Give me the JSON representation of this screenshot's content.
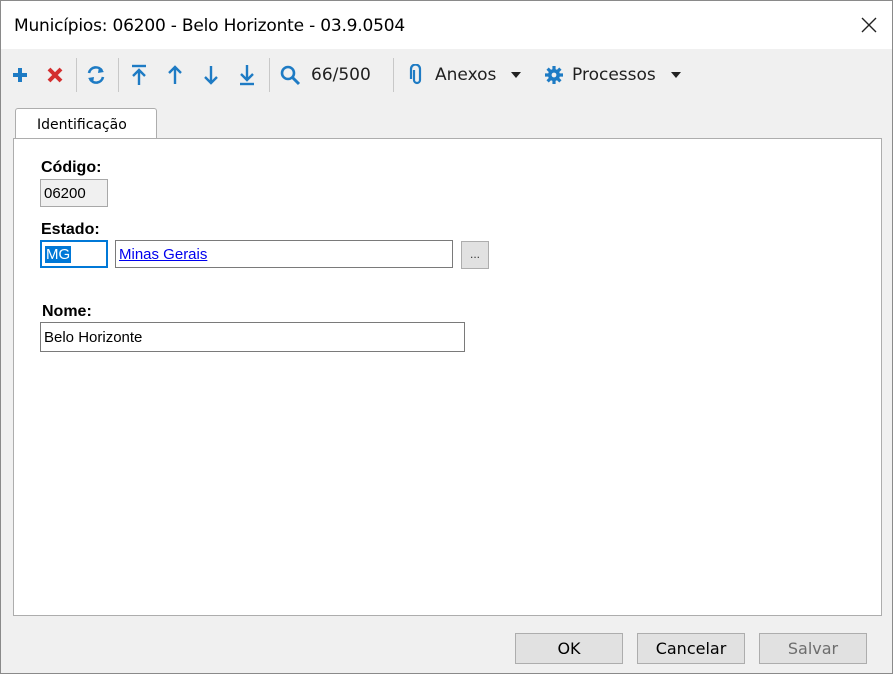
{
  "window": {
    "title": "Municípios: 06200 - Belo Horizonte - 03.9.0504"
  },
  "toolbar": {
    "record_counter": "66/500",
    "attachments_label": "Anexos",
    "processes_label": "Processos"
  },
  "tabs": [
    {
      "label": "Identificação",
      "active": true
    }
  ],
  "form": {
    "codigo": {
      "label": "Código:",
      "value": "06200"
    },
    "estado": {
      "label": "Estado:",
      "code": "MG",
      "name": "Minas Gerais",
      "browse_label": "..."
    },
    "nome": {
      "label": "Nome:",
      "value": "Belo Horizonte"
    }
  },
  "buttons": {
    "ok": "OK",
    "cancel": "Cancelar",
    "save": "Salvar"
  },
  "colors": {
    "icon_blue": "#1e7bc4",
    "delete_red": "#d32f2f",
    "selection": "#0078d7",
    "link": "#0000ee"
  }
}
